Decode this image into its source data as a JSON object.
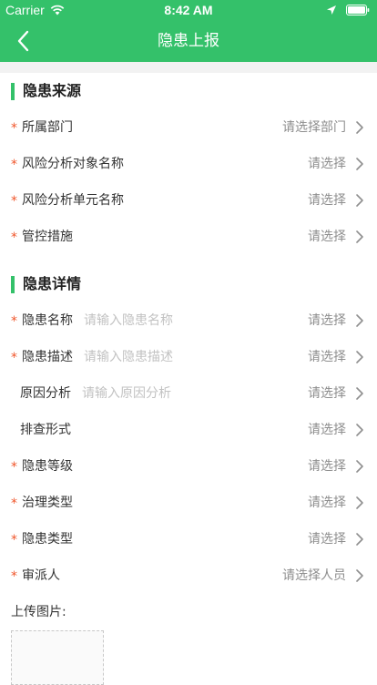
{
  "status_bar": {
    "carrier": "Carrier",
    "time": "8:42 AM"
  },
  "nav": {
    "title": "隐患上报",
    "back_icon": "chevron-left-icon"
  },
  "colors": {
    "brand": "#34c16a",
    "required": "#f0562b",
    "placeholder": "#c2c2c2",
    "value": "#8e8e8e"
  },
  "source_section": {
    "title": "隐患来源",
    "rows": [
      {
        "label": "所属部门",
        "required": "*",
        "value": "请选择部门"
      },
      {
        "label": "风险分析对象名称",
        "required": "*",
        "value": "请选择"
      },
      {
        "label": "风险分析单元名称",
        "required": "*",
        "value": "请选择"
      },
      {
        "label": "管控措施",
        "required": "*",
        "value": "请选择"
      }
    ]
  },
  "detail_section": {
    "title": "隐患详情",
    "rows": [
      {
        "label": "隐患名称",
        "required": "*",
        "placeholder": "请输入隐患名称",
        "value": "请选择"
      },
      {
        "label": "隐患描述",
        "required": "*",
        "placeholder": "请输入隐患描述",
        "value": "请选择"
      },
      {
        "label": "原因分析",
        "required": "",
        "placeholder": "请输入原因分析",
        "value": "请选择"
      },
      {
        "label": "排查形式",
        "required": "",
        "value": "请选择"
      },
      {
        "label": "隐患等级",
        "required": "*",
        "value": "请选择"
      },
      {
        "label": "治理类型",
        "required": "*",
        "value": "请选择"
      },
      {
        "label": "隐患类型",
        "required": "*",
        "value": "请选择"
      },
      {
        "label": "审派人",
        "required": "*",
        "value": "请选择人员"
      }
    ]
  },
  "upload": {
    "label": "上传图片:"
  }
}
